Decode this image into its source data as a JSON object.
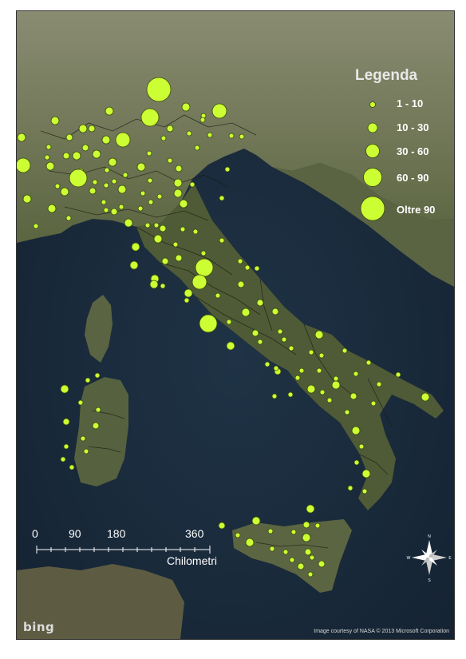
{
  "legend": {
    "title": "Legenda",
    "classes": [
      {
        "label": "1 - 10",
        "radius": 3.5
      },
      {
        "label": "10 - 30",
        "radius": 6
      },
      {
        "label": "30 - 60",
        "radius": 8.5
      },
      {
        "label": "60 - 90",
        "radius": 11.5
      },
      {
        "label": "Oltre 90",
        "radius": 15
      }
    ]
  },
  "scale_bar": {
    "ticks": [
      "0",
      "90",
      "180",
      "360"
    ],
    "unit": "Chilometri"
  },
  "compass": {
    "n": "N",
    "s": "S",
    "e": "E",
    "w": "W"
  },
  "attribution": {
    "logo": "bing",
    "credit": "Image courtesy of NASA © 2013 Microsoft Corporation"
  },
  "colors": {
    "symbol_fill": "#ccff33",
    "symbol_stroke": "#3a4a10",
    "sea": "#1b2b3d",
    "land": "#4d5a35",
    "mountains": "#7d8266"
  }
}
